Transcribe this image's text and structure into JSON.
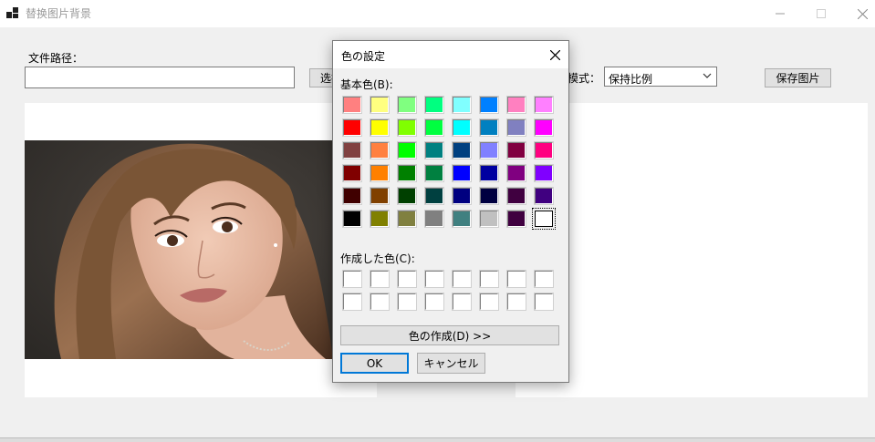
{
  "window": {
    "title": "替换图片背景",
    "icon": "app-icon"
  },
  "form": {
    "path_label": "文件路径：",
    "path_value": "",
    "select_button": "选择",
    "mode_label": "模式：",
    "mode_value": "保持比例",
    "save_button": "保存图片"
  },
  "color_dialog": {
    "title": "色の設定",
    "basic_colors_label": "基本色(B):",
    "custom_colors_label": "作成した色(C):",
    "define_button": "色の作成(D) >>",
    "ok_button": "OK",
    "cancel_button": "キャンセル",
    "basic_colors": [
      [
        "#ff8080",
        "#ffff80",
        "#80ff80",
        "#00ff80",
        "#80ffff",
        "#0080ff",
        "#ff80c0",
        "#ff80ff"
      ],
      [
        "#ff0000",
        "#ffff00",
        "#80ff00",
        "#00ff40",
        "#00ffff",
        "#0080c0",
        "#8080c0",
        "#ff00ff"
      ],
      [
        "#804040",
        "#ff8040",
        "#00ff00",
        "#008080",
        "#004080",
        "#8080ff",
        "#800040",
        "#ff0080"
      ],
      [
        "#800000",
        "#ff8000",
        "#008000",
        "#008040",
        "#0000ff",
        "#0000a0",
        "#800080",
        "#8000ff"
      ],
      [
        "#400000",
        "#804000",
        "#004000",
        "#004040",
        "#000080",
        "#000040",
        "#400040",
        "#400080"
      ],
      [
        "#000000",
        "#808000",
        "#808040",
        "#808080",
        "#408080",
        "#c0c0c0",
        "#400040",
        "#ffffff"
      ]
    ],
    "selected_color": "#ffffff",
    "custom_colors": [
      [
        "#ffffff",
        "#ffffff",
        "#ffffff",
        "#ffffff",
        "#ffffff",
        "#ffffff",
        "#ffffff",
        "#ffffff"
      ],
      [
        "#ffffff",
        "#ffffff",
        "#ffffff",
        "#ffffff",
        "#ffffff",
        "#ffffff",
        "#ffffff",
        "#ffffff"
      ]
    ]
  },
  "colors": {
    "accent": "#0078d7",
    "window_bg": "#f0f0f0"
  }
}
